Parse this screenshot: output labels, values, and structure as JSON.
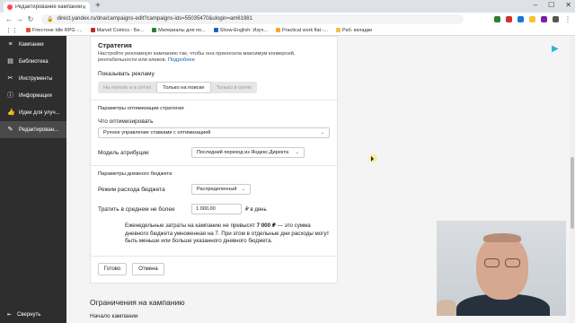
{
  "browser": {
    "tab_title": "Редактирование кампании",
    "url": "direct.yandex.ru/dna/campaigns-edit?campaigns-ids=55035470&ulogin=am61981",
    "bookmarks": [
      {
        "label": "Fireстоне Idle RPG -...",
        "color": "#e0552b"
      },
      {
        "label": "Marvel Comics - Бе...",
        "color": "#c62828"
      },
      {
        "label": "Материалы для по...",
        "color": "#2e7d32"
      },
      {
        "label": "Show-English: Изуч...",
        "color": "#1565c0"
      },
      {
        "label": "Practical work flat -...",
        "color": "#f9a825"
      },
      {
        "label": "Раб. вкладки",
        "color": "#f2c14e"
      }
    ]
  },
  "sidebar": {
    "items": [
      {
        "label": "Кампании",
        "icon": "stack-icon"
      },
      {
        "label": "Библиотека",
        "icon": "library-icon"
      },
      {
        "label": "Инструменты",
        "icon": "tools-icon"
      },
      {
        "label": "Информация",
        "icon": "info-icon"
      },
      {
        "label": "Идеи для улуч...",
        "icon": "thumb-up-icon"
      },
      {
        "label": "Редактирован...",
        "icon": "pencil-icon",
        "active": true
      }
    ],
    "collapse_label": "Свернуть"
  },
  "strategy": {
    "title": "Стратегия",
    "description": "Настройте рекламную кампанию так, чтобы она приносила максимум конверсий, рентабельности или кликов.",
    "more_link": "Подробнее",
    "show_ads_label": "Показывать рекламу",
    "show_options": [
      "На поиске и в сетях",
      "Только на поиске",
      "Только в сетях"
    ],
    "show_selected": 1
  },
  "optimization": {
    "section_title": "Параметры оптимизации стратегии",
    "what_label": "Что оптимизировать",
    "what_value": "Ручное управление ставками с оптимизацией",
    "attribution_label": "Модель атрибуции",
    "attribution_value": "Последний переход из Яндекс.Директа"
  },
  "budget": {
    "section_title": "Параметры дневного бюджета",
    "mode_label": "Режим расхода бюджета",
    "mode_value": "Распределенный",
    "spend_label": "Тратить в среднем не более",
    "spend_value": "1 000,00",
    "spend_unit": "₽ в день",
    "note_before": "Еженедельные затраты на кампанию не превысят",
    "note_amount": "7 000 ₽",
    "note_after": "— это сумма дневного бюджета умноженная на 7. При этом в отдельные дни расходы могут быть меньше или больше указанного дневного бюджета."
  },
  "actions": {
    "done_label": "Готово",
    "cancel_label": "Отмена"
  },
  "limits": {
    "title": "Ограничения на кампанию",
    "start_label": "Начало кампании"
  }
}
